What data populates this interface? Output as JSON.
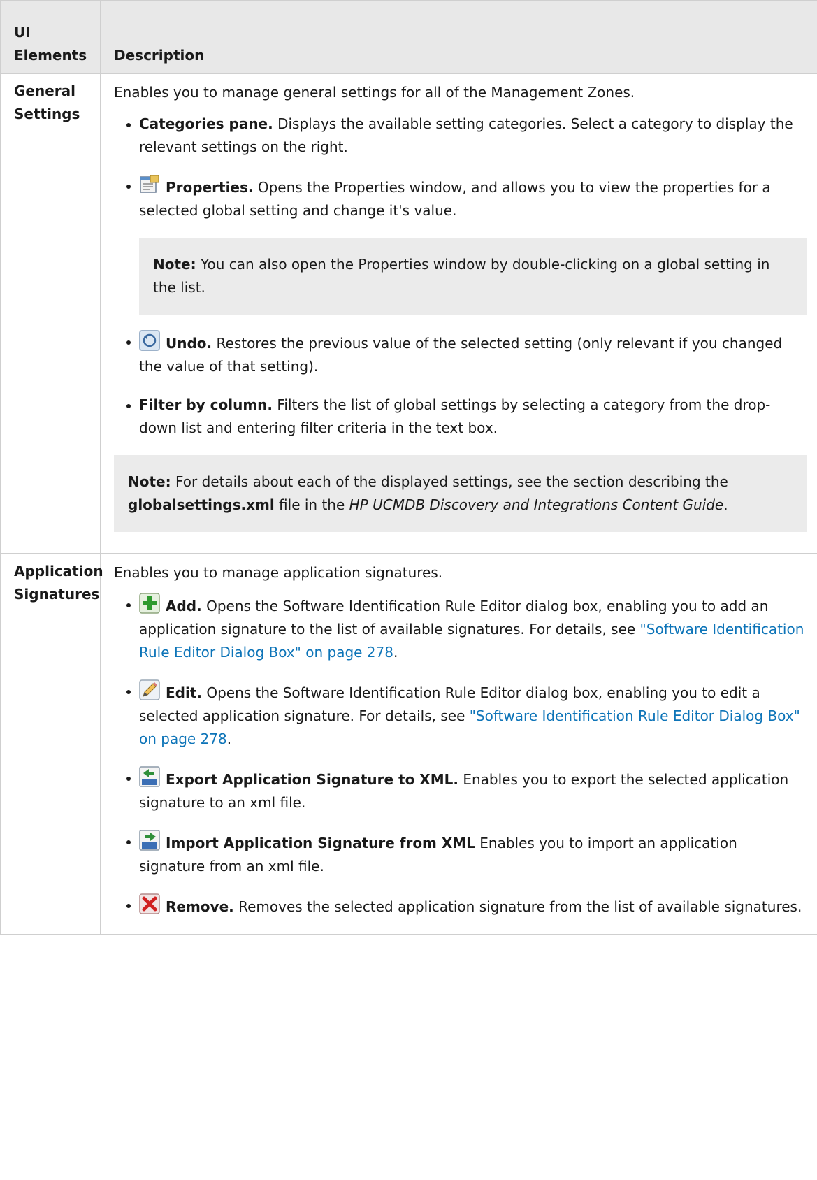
{
  "header": {
    "col1": "UI Elements",
    "col2": "Description"
  },
  "general": {
    "label": "General Settings",
    "intro": "Enables you to manage general settings for all of the Management Zones.",
    "categories": {
      "title": "Categories pane.",
      "text": " Displays the available setting categories. Select a category to display the relevant settings on the right."
    },
    "properties": {
      "title": "Properties.",
      "text": " Opens the Properties window, and allows you to view the properties for a selected global setting and change it's value."
    },
    "properties_note": {
      "label": "Note:",
      "text": " You can also open the Properties window by double-clicking on a global setting in the list."
    },
    "undo": {
      "title": "Undo.",
      "text": " Restores the previous value of the selected setting (only relevant if you changed the value of that setting)."
    },
    "filter": {
      "title": "Filter by column.",
      "text": " Filters the list of global settings by selecting a category from the drop-down list and entering filter criteria in the text box."
    },
    "note": {
      "label": "Note:",
      "text1": " For details about each of the displayed settings, see the section describing the ",
      "file": "globalsettings.xml",
      "text2": " file in the ",
      "guide": "HP UCMDB Discovery and Integrations Content Guide",
      "text3": "."
    }
  },
  "app": {
    "label": "Application Signatures",
    "intro": "Enables you to manage application signatures.",
    "add": {
      "title": "Add.",
      "text": " Opens the Software Identification Rule Editor dialog box, enabling you to add an application signature to the list of available signatures. For details, see ",
      "link": "\"Software Identification Rule Editor Dialog Box\" on page 278",
      "end": "."
    },
    "edit": {
      "title": "Edit.",
      "text": " Opens the Software Identification Rule Editor dialog box, enabling you to edit a selected application signature. For details, see ",
      "link": "\"Software Identification Rule Editor Dialog Box\" on page 278",
      "end": "."
    },
    "export": {
      "title": "Export Application Signature to XML.",
      "text": " Enables you to export the selected application signature to an xml file."
    },
    "import": {
      "title": "Import Application Signature from XML",
      "text": " Enables you to import an application signature from an xml file."
    },
    "remove": {
      "title": "Remove.",
      "text": " Removes the selected application signature from the list of available signatures."
    }
  },
  "icons": [
    "properties-icon",
    "undo-icon",
    "add-icon",
    "edit-icon",
    "export-xml-icon",
    "import-xml-icon",
    "remove-icon"
  ],
  "colors": {
    "header_bg": "#e8e8e8",
    "note_bg": "#ebebeb",
    "link": "#0d74b8",
    "border": "#cfcfcf"
  }
}
